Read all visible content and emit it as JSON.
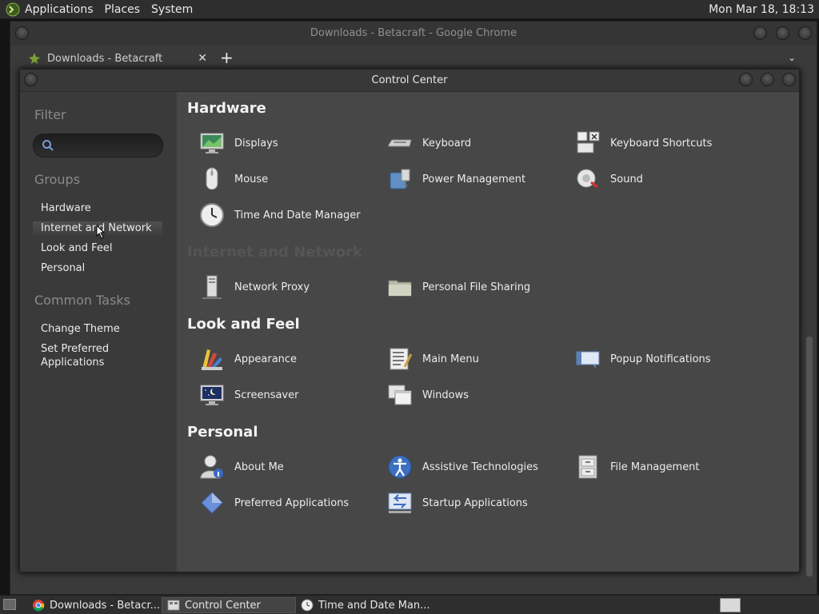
{
  "top_panel": {
    "menus": [
      "Applications",
      "Places",
      "System"
    ],
    "clock": "Mon Mar 18, 18:13"
  },
  "chrome": {
    "title": "Downloads - Betacraft - Google Chrome",
    "tab_label": "Downloads - Betacraft",
    "tab_close": "✕",
    "new_tab": "+",
    "tab_menu": "⌄"
  },
  "control_center": {
    "title": "Control Center",
    "sidebar": {
      "filter_heading": "Filter",
      "filter_value": "",
      "groups_heading": "Groups",
      "groups": [
        "Hardware",
        "Internet and Network",
        "Look and Feel",
        "Personal"
      ],
      "tasks_heading": "Common Tasks",
      "tasks": [
        "Change Theme",
        "Set Preferred Applications"
      ]
    },
    "sections": [
      {
        "title": "Hardware",
        "items": [
          {
            "label": "Displays",
            "icon": "display-icon"
          },
          {
            "label": "Keyboard",
            "icon": "keyboard-icon"
          },
          {
            "label": "Keyboard Shortcuts",
            "icon": "keyboard-shortcuts-icon"
          },
          {
            "label": "Mouse",
            "icon": "mouse-icon"
          },
          {
            "label": "Power Management",
            "icon": "power-management-icon"
          },
          {
            "label": "Sound",
            "icon": "sound-icon"
          },
          {
            "label": "Time And Date Manager",
            "icon": "clock-icon"
          }
        ]
      },
      {
        "title": "Internet and Network",
        "items": [
          {
            "label": "Network Proxy",
            "icon": "network-proxy-icon"
          },
          {
            "label": "Personal File Sharing",
            "icon": "folder-share-icon"
          }
        ]
      },
      {
        "title": "Look and Feel",
        "items": [
          {
            "label": "Appearance",
            "icon": "appearance-icon"
          },
          {
            "label": "Main Menu",
            "icon": "main-menu-icon"
          },
          {
            "label": "Popup Notifications",
            "icon": "popup-notifications-icon"
          },
          {
            "label": "Screensaver",
            "icon": "screensaver-icon"
          },
          {
            "label": "Windows",
            "icon": "windows-icon"
          }
        ]
      },
      {
        "title": "Personal",
        "items": [
          {
            "label": "About Me",
            "icon": "about-me-icon"
          },
          {
            "label": "Assistive Technologies",
            "icon": "accessibility-icon"
          },
          {
            "label": "File Management",
            "icon": "file-management-icon"
          },
          {
            "label": "Preferred Applications",
            "icon": "preferred-apps-icon"
          },
          {
            "label": "Startup Applications",
            "icon": "startup-apps-icon"
          }
        ]
      }
    ]
  },
  "taskbar": {
    "tasks": [
      {
        "label": "Downloads - Betacr...",
        "icon": "chrome-icon"
      },
      {
        "label": "Control Center",
        "icon": "control-center-icon"
      },
      {
        "label": "Time and Date Man...",
        "icon": "clock-icon"
      }
    ]
  }
}
